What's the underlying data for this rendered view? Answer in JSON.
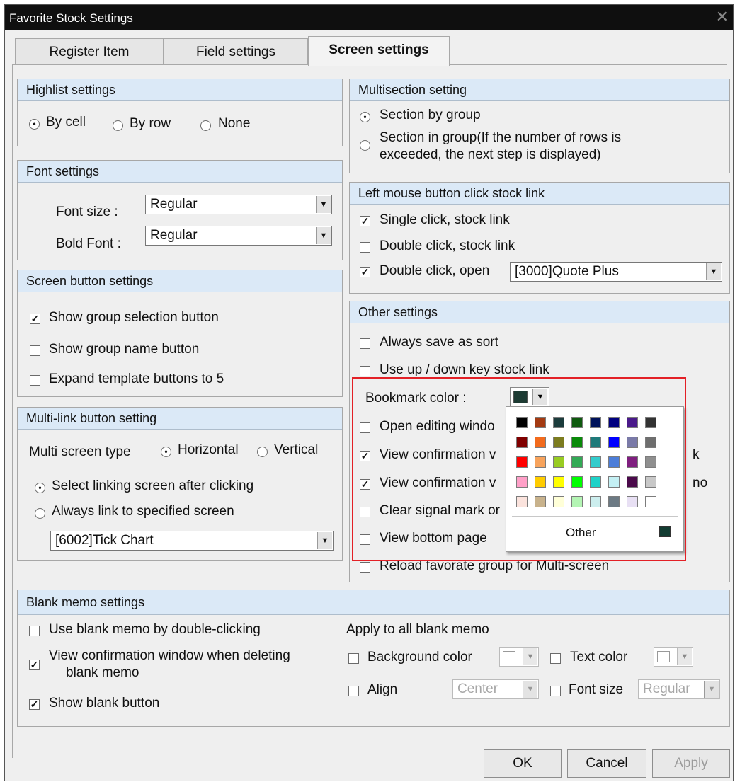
{
  "window": {
    "title": "Favorite Stock Settings",
    "close_symbol": "✕"
  },
  "tabs": [
    {
      "label": "Register Item"
    },
    {
      "label": "Field settings"
    },
    {
      "label": "Screen settings",
      "active": true
    }
  ],
  "highlist": {
    "title": "Highlist settings",
    "options": [
      {
        "label": "By cell",
        "selected": true
      },
      {
        "label": "By row",
        "selected": false
      },
      {
        "label": "None",
        "selected": false
      }
    ]
  },
  "font_settings": {
    "title": "Font settings",
    "font_size_label": "Font size :",
    "font_size_value": "Regular",
    "bold_font_label": "Bold Font :",
    "bold_font_value": "Regular"
  },
  "screen_button": {
    "title": "Screen button settings",
    "items": [
      {
        "label": "Show group selection button",
        "checked": true
      },
      {
        "label": "Show group name button",
        "checked": false
      },
      {
        "label": "Expand template buttons to 5",
        "checked": false
      }
    ]
  },
  "multilink": {
    "title": "Multi-link button setting",
    "type_label": "Multi screen type",
    "type_options": [
      {
        "label": "Horizontal",
        "selected": true
      },
      {
        "label": "Vertical",
        "selected": false
      }
    ],
    "link_options": [
      {
        "label": "Select linking screen after clicking",
        "selected": true
      },
      {
        "label": "Always link to specified screen",
        "selected": false
      }
    ],
    "screen_value": "[6002]Tick Chart"
  },
  "multisection": {
    "title": "Multisection setting",
    "option1": "Section by group",
    "option2_line1": "Section in group(If the number of rows is",
    "option2_line2": "exceeded, the next step is displayed)"
  },
  "left_click": {
    "title": "Left mouse button click stock link",
    "items": [
      {
        "label": "Single click, stock link",
        "checked": true
      },
      {
        "label": "Double click, stock link",
        "checked": false
      },
      {
        "label": "Double click, open",
        "checked": true
      }
    ],
    "open_value": "[3000]Quote Plus"
  },
  "other": {
    "title": "Other settings",
    "items": [
      {
        "label": "Always save as sort",
        "checked": false
      },
      {
        "label": "Use up / down key stock link",
        "checked": false
      }
    ],
    "bookmark_label": "Bookmark color :",
    "hidden_items": [
      {
        "label": "Open editing windo",
        "checked": false
      },
      {
        "label": "View confirmation v",
        "checked": true,
        "tail": "k"
      },
      {
        "label": "View confirmation v",
        "checked": true,
        "tail": "no"
      },
      {
        "label": "Clear signal mark or",
        "checked": false
      },
      {
        "label": "View bottom page",
        "checked": false
      }
    ],
    "reload_label": "Reload favorate group for Multi-screen"
  },
  "color_picker": {
    "selected_color": "#1d3b33",
    "other_label": "Other",
    "other_color": "#123c32",
    "rows": [
      [
        "#000000",
        "#a33a12",
        "#1c3c3c",
        "#0f5a0f",
        "#00135a",
        "#00007f",
        "#4a1a8a",
        "#333333"
      ],
      [
        "#800000",
        "#f26b1d",
        "#7c7c1f",
        "#0a8a0a",
        "#1f7a7a",
        "#0000ff",
        "#7a7aa8",
        "#6e6e6e"
      ],
      [
        "#ff0000",
        "#f7a35c",
        "#99cc22",
        "#33aa55",
        "#33cccc",
        "#4d7ed9",
        "#7f1f7f",
        "#8f8f8f"
      ],
      [
        "#ffa0c8",
        "#ffcc00",
        "#ffff00",
        "#00ff00",
        "#1fd2c8",
        "#c4f0f4",
        "#4b0a4b",
        "#c8c8c8"
      ],
      [
        "#fbe3dd",
        "#c8b28c",
        "#ffffd8",
        "#b4f5b4",
        "#cceeee",
        "#6c7a84",
        "#e8e0f4",
        "#ffffff"
      ]
    ]
  },
  "blank_memo": {
    "title": "Blank memo settings",
    "items": [
      {
        "label": "Use blank memo by double-clicking",
        "checked": false
      },
      {
        "label_line1": "View confirmation window when deleting",
        "label_line2": "blank memo",
        "checked": true
      },
      {
        "label": "Show blank button",
        "checked": true
      }
    ],
    "apply_label": "Apply to all blank memo",
    "bg_label": "Background color",
    "text_color_label": "Text color",
    "align_label": "Align",
    "align_value": "Center",
    "font_size_label": "Font size",
    "font_size_value": "Regular"
  },
  "footer": {
    "ok": "OK",
    "cancel": "Cancel",
    "apply": "Apply"
  },
  "glyphs": {
    "check": "✓",
    "dot": "•",
    "arrow": "▼"
  }
}
